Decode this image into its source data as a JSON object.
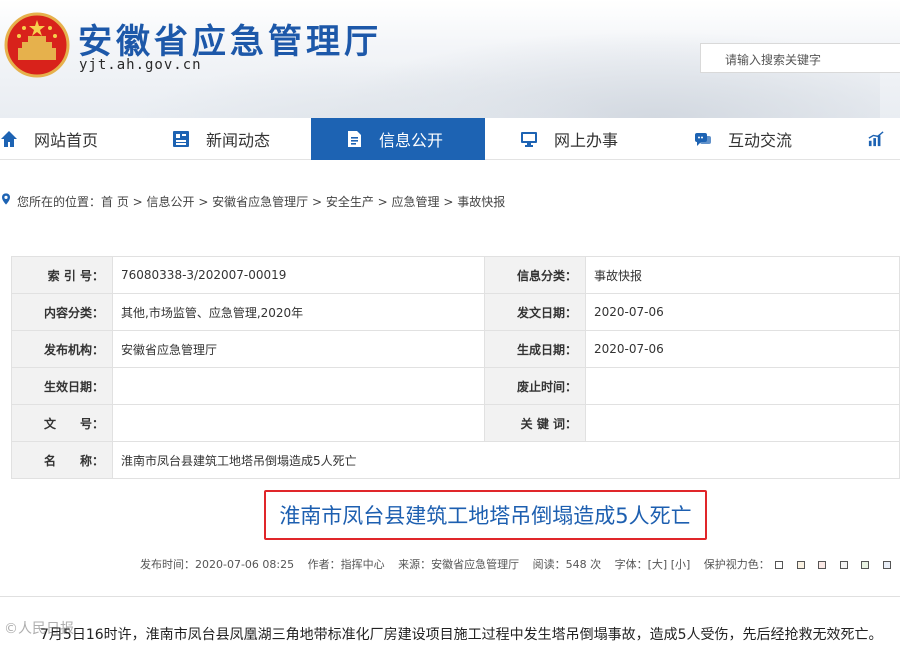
{
  "header": {
    "site_name": "安徽省应急管理厅",
    "domain": "yjt.ah.gov.cn",
    "search_placeholder": "请输入搜索关键字"
  },
  "nav": {
    "items": [
      {
        "label": "网站首页",
        "icon": "home-icon"
      },
      {
        "label": "新闻动态",
        "icon": "news-icon"
      },
      {
        "label": "信息公开",
        "icon": "document-icon",
        "active": true
      },
      {
        "label": "网上办事",
        "icon": "monitor-icon"
      },
      {
        "label": "互动交流",
        "icon": "chat-icon"
      },
      {
        "label": "",
        "icon": "chart-icon"
      }
    ]
  },
  "breadcrumb": "您所在的位置：首 页 > 信息公开 > 安徽省应急管理厅 > 安全生产 > 应急管理 > 事故快报",
  "meta": {
    "index_label": "索 引 号：",
    "index_value": "76080338-3/202007-00019",
    "category_label": "信息分类：",
    "category_value": "事故快报",
    "content_label": "内容分类：",
    "content_value": "其他,市场监管、应急管理,2020年",
    "issue_date_label": "发文日期：",
    "issue_date_value": "2020-07-06",
    "publisher_label": "发布机构：",
    "publisher_value": "安徽省应急管理厅",
    "created_label": "生成日期：",
    "created_value": "2020-07-06",
    "effective_label": "生效日期：",
    "effective_value": "",
    "abolish_label": "废止时间：",
    "abolish_value": "",
    "doc_no_label": "文　　号：",
    "doc_no_value": "",
    "keywords_label": "关 键 词：",
    "keywords_value": "",
    "name_label": "名　　称：",
    "name_value": "淮南市凤台县建筑工地塔吊倒塌造成5人死亡"
  },
  "article": {
    "title": "淮南市凤台县建筑工地塔吊倒塌造成5人死亡",
    "publish_time": "发布时间：2020-07-06 08:25",
    "author": "作者：指挥中心",
    "source": "来源：安徽省应急管理厅",
    "views": "阅读：548 次",
    "font_size": "字体：[大] [小]",
    "eye_color": "保护视力色：",
    "body": "7月5日16时许，淮南市凤台县凤凰湖三角地带标准化厂房建设项目施工过程中发生塔吊倒塌事故，造成5人受伤，先后经抢救无效死亡。",
    "watermark": "©人民日报"
  },
  "colors": {
    "brand": "#1d58a9",
    "nav_active": "#1d63b3",
    "title_border": "#e0262a"
  }
}
